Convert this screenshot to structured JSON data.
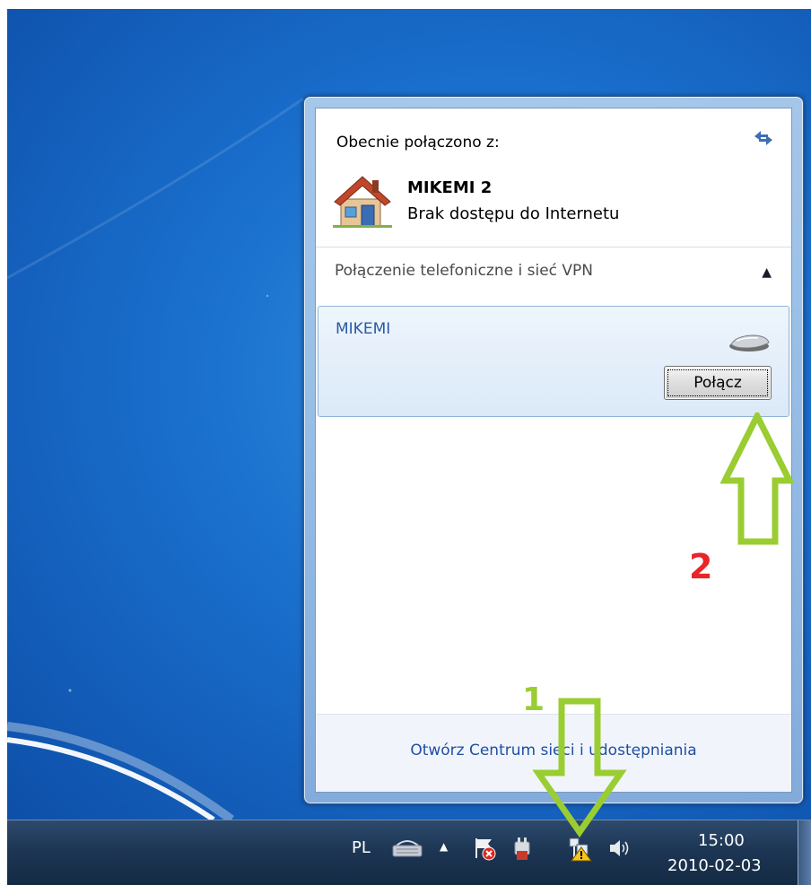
{
  "popup": {
    "current_connection_label": "Obecnie połączono z:",
    "network_name": "MIKEMI  2",
    "network_status": "Brak dostępu do Internetu",
    "vpn_section_title": "Połączenie telefoniczne i sieć VPN",
    "vpn_item_name": "MIKEMI",
    "connect_button": "Połącz",
    "footer_link": "Otwórz Centrum sieci i udostępniania"
  },
  "taskbar": {
    "language": "PL",
    "time": "15:00",
    "date": "2010-02-03"
  },
  "annotations": {
    "step1": "1",
    "step2": "2",
    "arrow_color": "#9acd32",
    "step2_color": "#e8262a"
  },
  "icons": {
    "refresh": "refresh-icon",
    "home_network": "house-icon",
    "modem": "modem-icon",
    "keyboard": "keyboard-icon",
    "action_center": "flag-icon",
    "power": "power-plug-icon",
    "network_warning": "network-warning-icon",
    "volume": "speaker-icon"
  }
}
